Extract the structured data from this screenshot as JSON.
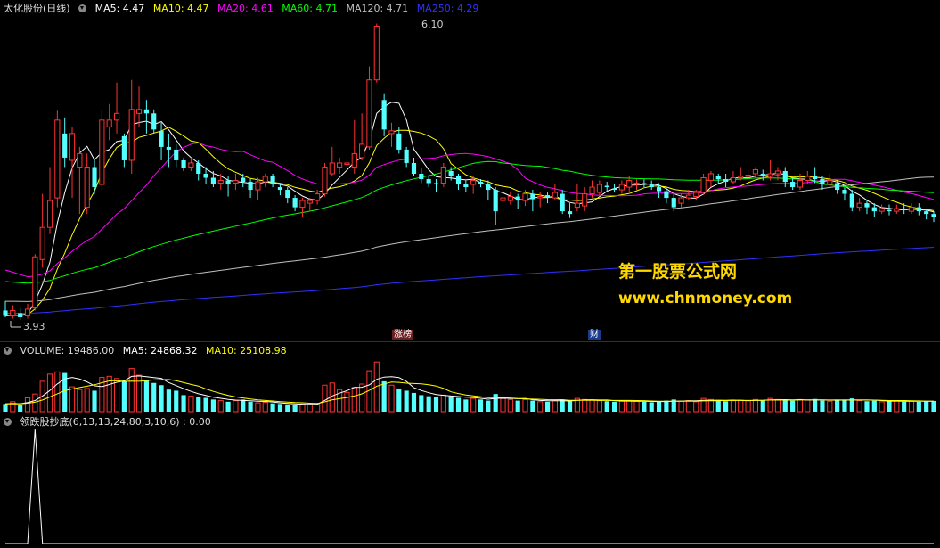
{
  "main_header": {
    "stock": "太化股份(日线)",
    "ma5": "MA5: 4.47",
    "ma10": "MA10: 4.47",
    "ma20": "MA20: 4.61",
    "ma60": "MA60: 4.71",
    "ma120": "MA120: 4.71",
    "ma250": "MA250: 4.29"
  },
  "vol_header": {
    "volume": "VOLUME: 19486.00",
    "ma5": "MA5: 24868.32",
    "ma10": "MA10: 25108.98"
  },
  "ind_header": {
    "label": "领跌股抄底(6,13,13,24,80,3,10,6) : 0.00"
  },
  "annotations": {
    "high": "6.10",
    "low": "3.93",
    "tag1": "涨榜",
    "tag2": "财"
  },
  "watermark": {
    "line1": "第一股票公式网",
    "line2": "www.chnmoney.com"
  },
  "colors": {
    "up": "#ff3232",
    "down": "#54ffff",
    "ma5": "#ffffff",
    "ma10": "#ffff00",
    "ma20": "#ff00ff",
    "ma60": "#00ff00",
    "ma120": "#c0c0c0",
    "ma250": "#3030ff",
    "separator": "#a00000"
  },
  "chart_data": [
    {
      "type": "candlestick",
      "title": "太化股份(日线)",
      "ylim": [
        3.85,
        6.15
      ],
      "candles": [
        [
          3.98,
          3.94,
          4.05,
          3.93
        ],
        [
          3.94,
          3.98,
          4.02,
          3.92
        ],
        [
          3.96,
          3.93,
          4.0,
          3.91
        ],
        [
          3.94,
          3.99,
          4.03,
          3.92
        ],
        [
          4.0,
          4.38,
          4.4,
          3.98
        ],
        [
          4.36,
          4.6,
          4.85,
          4.3
        ],
        [
          4.6,
          4.8,
          5.05,
          4.55
        ],
        [
          4.82,
          5.4,
          5.47,
          4.75
        ],
        [
          5.3,
          5.12,
          5.42,
          5.05
        ],
        [
          5.1,
          5.3,
          5.35,
          4.82
        ],
        [
          5.05,
          5.15,
          5.2,
          4.7
        ],
        [
          4.75,
          5.05,
          5.15,
          4.7
        ],
        [
          5.05,
          4.9,
          5.1,
          4.85
        ],
        [
          4.92,
          5.4,
          5.48,
          4.88
        ],
        [
          5.35,
          5.4,
          5.52,
          5.25
        ],
        [
          5.4,
          5.45,
          5.68,
          5.3
        ],
        [
          5.28,
          5.1,
          5.3,
          5.05
        ],
        [
          5.1,
          5.48,
          5.7,
          5.0
        ],
        [
          5.45,
          5.48,
          5.65,
          5.35
        ],
        [
          5.48,
          5.45,
          5.55,
          5.3
        ],
        [
          5.45,
          5.33,
          5.48,
          5.3
        ],
        [
          5.32,
          5.2,
          5.38,
          5.1
        ],
        [
          5.2,
          5.18,
          5.3,
          5.05
        ],
        [
          5.18,
          5.1,
          5.22,
          5.05
        ],
        [
          5.1,
          5.04,
          5.12,
          5.02
        ],
        [
          5.05,
          5.08,
          5.12,
          5.02
        ],
        [
          5.08,
          5.0,
          5.1,
          4.95
        ],
        [
          5.0,
          4.97,
          5.05,
          4.92
        ],
        [
          4.97,
          4.92,
          5.02,
          4.9
        ],
        [
          4.93,
          4.95,
          5.0,
          4.88
        ],
        [
          4.95,
          4.92,
          4.98,
          4.83
        ],
        [
          4.93,
          4.95,
          5.0,
          4.88
        ],
        [
          4.97,
          4.94,
          5.0,
          4.9
        ],
        [
          4.94,
          4.88,
          4.96,
          4.82
        ],
        [
          4.88,
          4.94,
          4.97,
          4.8
        ],
        [
          4.94,
          4.98,
          5.0,
          4.9
        ],
        [
          4.98,
          4.92,
          5.0,
          4.9
        ],
        [
          4.9,
          4.88,
          4.93,
          4.84
        ],
        [
          4.88,
          4.82,
          4.9,
          4.78
        ],
        [
          4.82,
          4.75,
          4.84,
          4.72
        ],
        [
          4.75,
          4.8,
          4.82,
          4.68
        ],
        [
          4.78,
          4.8,
          4.82,
          4.72
        ],
        [
          4.8,
          4.85,
          4.88,
          4.77
        ],
        [
          4.85,
          5.05,
          5.08,
          4.83
        ],
        [
          5.0,
          5.08,
          5.2,
          4.98
        ],
        [
          5.05,
          5.08,
          5.12,
          5.0
        ],
        [
          5.07,
          5.08,
          5.12,
          5.03
        ],
        [
          5.05,
          5.15,
          5.4,
          5.0
        ],
        [
          5.12,
          5.22,
          5.45,
          5.1
        ],
        [
          5.2,
          5.7,
          5.8,
          5.18
        ],
        [
          5.7,
          6.1,
          6.12,
          5.68
        ],
        [
          5.55,
          5.33,
          5.6,
          5.28
        ],
        [
          5.3,
          5.32,
          5.38,
          5.2
        ],
        [
          5.3,
          5.18,
          5.35,
          5.15
        ],
        [
          5.18,
          5.08,
          5.2,
          5.05
        ],
        [
          5.08,
          5.0,
          5.12,
          4.98
        ],
        [
          5.0,
          4.96,
          5.04,
          4.93
        ],
        [
          4.96,
          4.93,
          4.98,
          4.9
        ],
        [
          4.93,
          4.92,
          4.96,
          4.86
        ],
        [
          4.93,
          5.05,
          5.08,
          4.9
        ],
        [
          5.02,
          4.98,
          5.05,
          4.95
        ],
        [
          4.98,
          4.92,
          5.0,
          4.88
        ],
        [
          4.92,
          4.9,
          4.95,
          4.86
        ],
        [
          4.92,
          4.95,
          4.98,
          4.85
        ],
        [
          4.94,
          4.92,
          4.96,
          4.9
        ],
        [
          4.92,
          4.88,
          4.95,
          4.8
        ],
        [
          4.88,
          4.72,
          4.9,
          4.62
        ],
        [
          4.8,
          4.82,
          4.88,
          4.74
        ],
        [
          4.8,
          4.83,
          4.86,
          4.77
        ],
        [
          4.83,
          4.8,
          4.85,
          4.74
        ],
        [
          4.8,
          4.85,
          4.88,
          4.76
        ],
        [
          4.85,
          4.81,
          4.88,
          4.72
        ],
        [
          4.82,
          4.83,
          4.86,
          4.75
        ],
        [
          4.84,
          4.82,
          4.86,
          4.78
        ],
        [
          4.82,
          4.86,
          4.92,
          4.8
        ],
        [
          4.85,
          4.72,
          4.88,
          4.7
        ],
        [
          4.72,
          4.7,
          4.78,
          4.67
        ],
        [
          4.75,
          4.78,
          4.92,
          4.72
        ],
        [
          4.76,
          4.85,
          4.9,
          4.72
        ],
        [
          4.85,
          4.9,
          4.95,
          4.82
        ],
        [
          4.86,
          4.92,
          4.95,
          4.84
        ],
        [
          4.91,
          4.9,
          4.94,
          4.86
        ],
        [
          4.89,
          4.88,
          4.92,
          4.86
        ],
        [
          4.88,
          4.92,
          4.95,
          4.85
        ],
        [
          4.9,
          4.95,
          4.98,
          4.85
        ],
        [
          4.92,
          4.93,
          4.96,
          4.88
        ],
        [
          4.93,
          4.92,
          4.96,
          4.9
        ],
        [
          4.92,
          4.9,
          4.95,
          4.88
        ],
        [
          4.9,
          4.87,
          4.93,
          4.82
        ],
        [
          4.87,
          4.82,
          4.9,
          4.78
        ],
        [
          4.82,
          4.75,
          4.85,
          4.72
        ],
        [
          4.78,
          4.82,
          4.85,
          4.75
        ],
        [
          4.82,
          4.84,
          4.88,
          4.8
        ],
        [
          4.83,
          4.86,
          4.88,
          4.8
        ],
        [
          4.86,
          4.97,
          5.0,
          4.84
        ],
        [
          4.95,
          5.0,
          5.02,
          4.9
        ],
        [
          4.98,
          4.96,
          5.0,
          4.93
        ],
        [
          4.96,
          4.94,
          5.0,
          4.9
        ],
        [
          4.94,
          4.97,
          5.02,
          4.92
        ],
        [
          4.97,
          4.98,
          5.05,
          4.95
        ],
        [
          4.98,
          4.99,
          5.03,
          4.94
        ],
        [
          5.0,
          5.03,
          5.05,
          4.97
        ],
        [
          5.0,
          4.98,
          5.03,
          4.95
        ],
        [
          4.98,
          5.0,
          5.1,
          4.95
        ],
        [
          5.0,
          5.02,
          5.05,
          4.95
        ],
        [
          5.02,
          4.94,
          5.05,
          4.9
        ],
        [
          4.94,
          4.9,
          4.97,
          4.88
        ],
        [
          4.9,
          4.95,
          5.0,
          4.88
        ],
        [
          4.95,
          4.98,
          5.02,
          4.92
        ],
        [
          4.98,
          4.96,
          5.05,
          4.93
        ],
        [
          4.96,
          4.92,
          4.98,
          4.88
        ],
        [
          4.92,
          4.95,
          5.0,
          4.9
        ],
        [
          4.93,
          4.88,
          4.95,
          4.85
        ],
        [
          4.88,
          4.85,
          4.9,
          4.8
        ],
        [
          4.85,
          4.75,
          4.88,
          4.72
        ],
        [
          4.75,
          4.78,
          4.82,
          4.72
        ],
        [
          4.78,
          4.75,
          4.8,
          4.7
        ],
        [
          4.75,
          4.72,
          4.78,
          4.68
        ],
        [
          4.72,
          4.74,
          4.77,
          4.7
        ],
        [
          4.73,
          4.72,
          4.77,
          4.69
        ],
        [
          4.72,
          4.74,
          4.77,
          4.7
        ],
        [
          4.74,
          4.73,
          4.78,
          4.7
        ],
        [
          4.72,
          4.75,
          4.78,
          4.7
        ],
        [
          4.75,
          4.72,
          4.78,
          4.69
        ],
        [
          4.72,
          4.7,
          4.74,
          4.66
        ],
        [
          4.7,
          4.68,
          4.72,
          4.64
        ]
      ],
      "series": [
        {
          "name": "MA5",
          "values": []
        },
        {
          "name": "MA10",
          "values": []
        },
        {
          "name": "MA20",
          "values": []
        },
        {
          "name": "MA60",
          "values": []
        },
        {
          "name": "MA120",
          "values": []
        },
        {
          "name": "MA250",
          "values": []
        }
      ],
      "annotations": [
        {
          "label": "6.10"
        },
        {
          "label": "3.93"
        }
      ]
    },
    {
      "type": "bar",
      "title": "VOLUME",
      "ylim": [
        0,
        100000
      ],
      "values": [
        14000,
        18000,
        12000,
        25000,
        32000,
        55000,
        68000,
        72000,
        70000,
        45000,
        40000,
        42000,
        38000,
        62000,
        64000,
        60000,
        55000,
        78000,
        66000,
        58000,
        52000,
        48000,
        40000,
        38000,
        30000,
        28000,
        26000,
        25000,
        22000,
        20000,
        18000,
        20000,
        22000,
        18000,
        16000,
        17000,
        15000,
        14000,
        13000,
        12000,
        14000,
        13000,
        15000,
        48000,
        52000,
        40000,
        35000,
        44000,
        50000,
        74000,
        90000,
        55000,
        48000,
        42000,
        38000,
        34000,
        30000,
        28000,
        26000,
        30000,
        28000,
        25000,
        22000,
        24000,
        22000,
        20000,
        32000,
        24000,
        22000,
        20000,
        22000,
        20000,
        18000,
        18000,
        20000,
        22000,
        19000,
        24000,
        22000,
        21000,
        20000,
        19000,
        18000,
        19000,
        20000,
        19000,
        18000,
        17000,
        18000,
        20000,
        22000,
        19000,
        20000,
        18000,
        24000,
        22000,
        20000,
        19000,
        20000,
        21000,
        20000,
        22000,
        20000,
        24000,
        22000,
        21000,
        20000,
        22000,
        21000,
        23000,
        20000,
        19000,
        21000,
        22000,
        24000,
        20000,
        19000,
        20000,
        18000,
        19000,
        20000,
        18000,
        19000,
        18000,
        19500,
        19486
      ],
      "series": [
        {
          "name": "MA5",
          "values": []
        },
        {
          "name": "MA10",
          "values": []
        }
      ]
    },
    {
      "type": "line",
      "title": "领跌股抄底(6,13,13,24,80,3,10,6)",
      "ylim": [
        0,
        1
      ],
      "values": [
        0,
        0,
        0,
        0,
        1,
        0,
        0,
        0,
        0,
        0,
        0,
        0,
        0,
        0,
        0,
        0,
        0,
        0,
        0,
        0,
        0,
        0,
        0,
        0,
        0,
        0,
        0,
        0,
        0,
        0,
        0,
        0,
        0,
        0,
        0,
        0,
        0,
        0,
        0,
        0,
        0,
        0,
        0,
        0,
        0,
        0,
        0,
        0,
        0,
        0,
        0,
        0,
        0,
        0,
        0,
        0,
        0,
        0,
        0,
        0,
        0,
        0,
        0,
        0,
        0,
        0,
        0,
        0,
        0,
        0,
        0,
        0,
        0,
        0,
        0,
        0,
        0,
        0,
        0,
        0,
        0,
        0,
        0,
        0,
        0,
        0,
        0,
        0,
        0,
        0,
        0,
        0,
        0,
        0,
        0,
        0,
        0,
        0,
        0,
        0,
        0,
        0,
        0,
        0,
        0,
        0,
        0,
        0,
        0,
        0,
        0,
        0,
        0,
        0,
        0,
        0,
        0,
        0,
        0,
        0,
        0,
        0,
        0,
        0,
        0,
        0
      ]
    }
  ]
}
